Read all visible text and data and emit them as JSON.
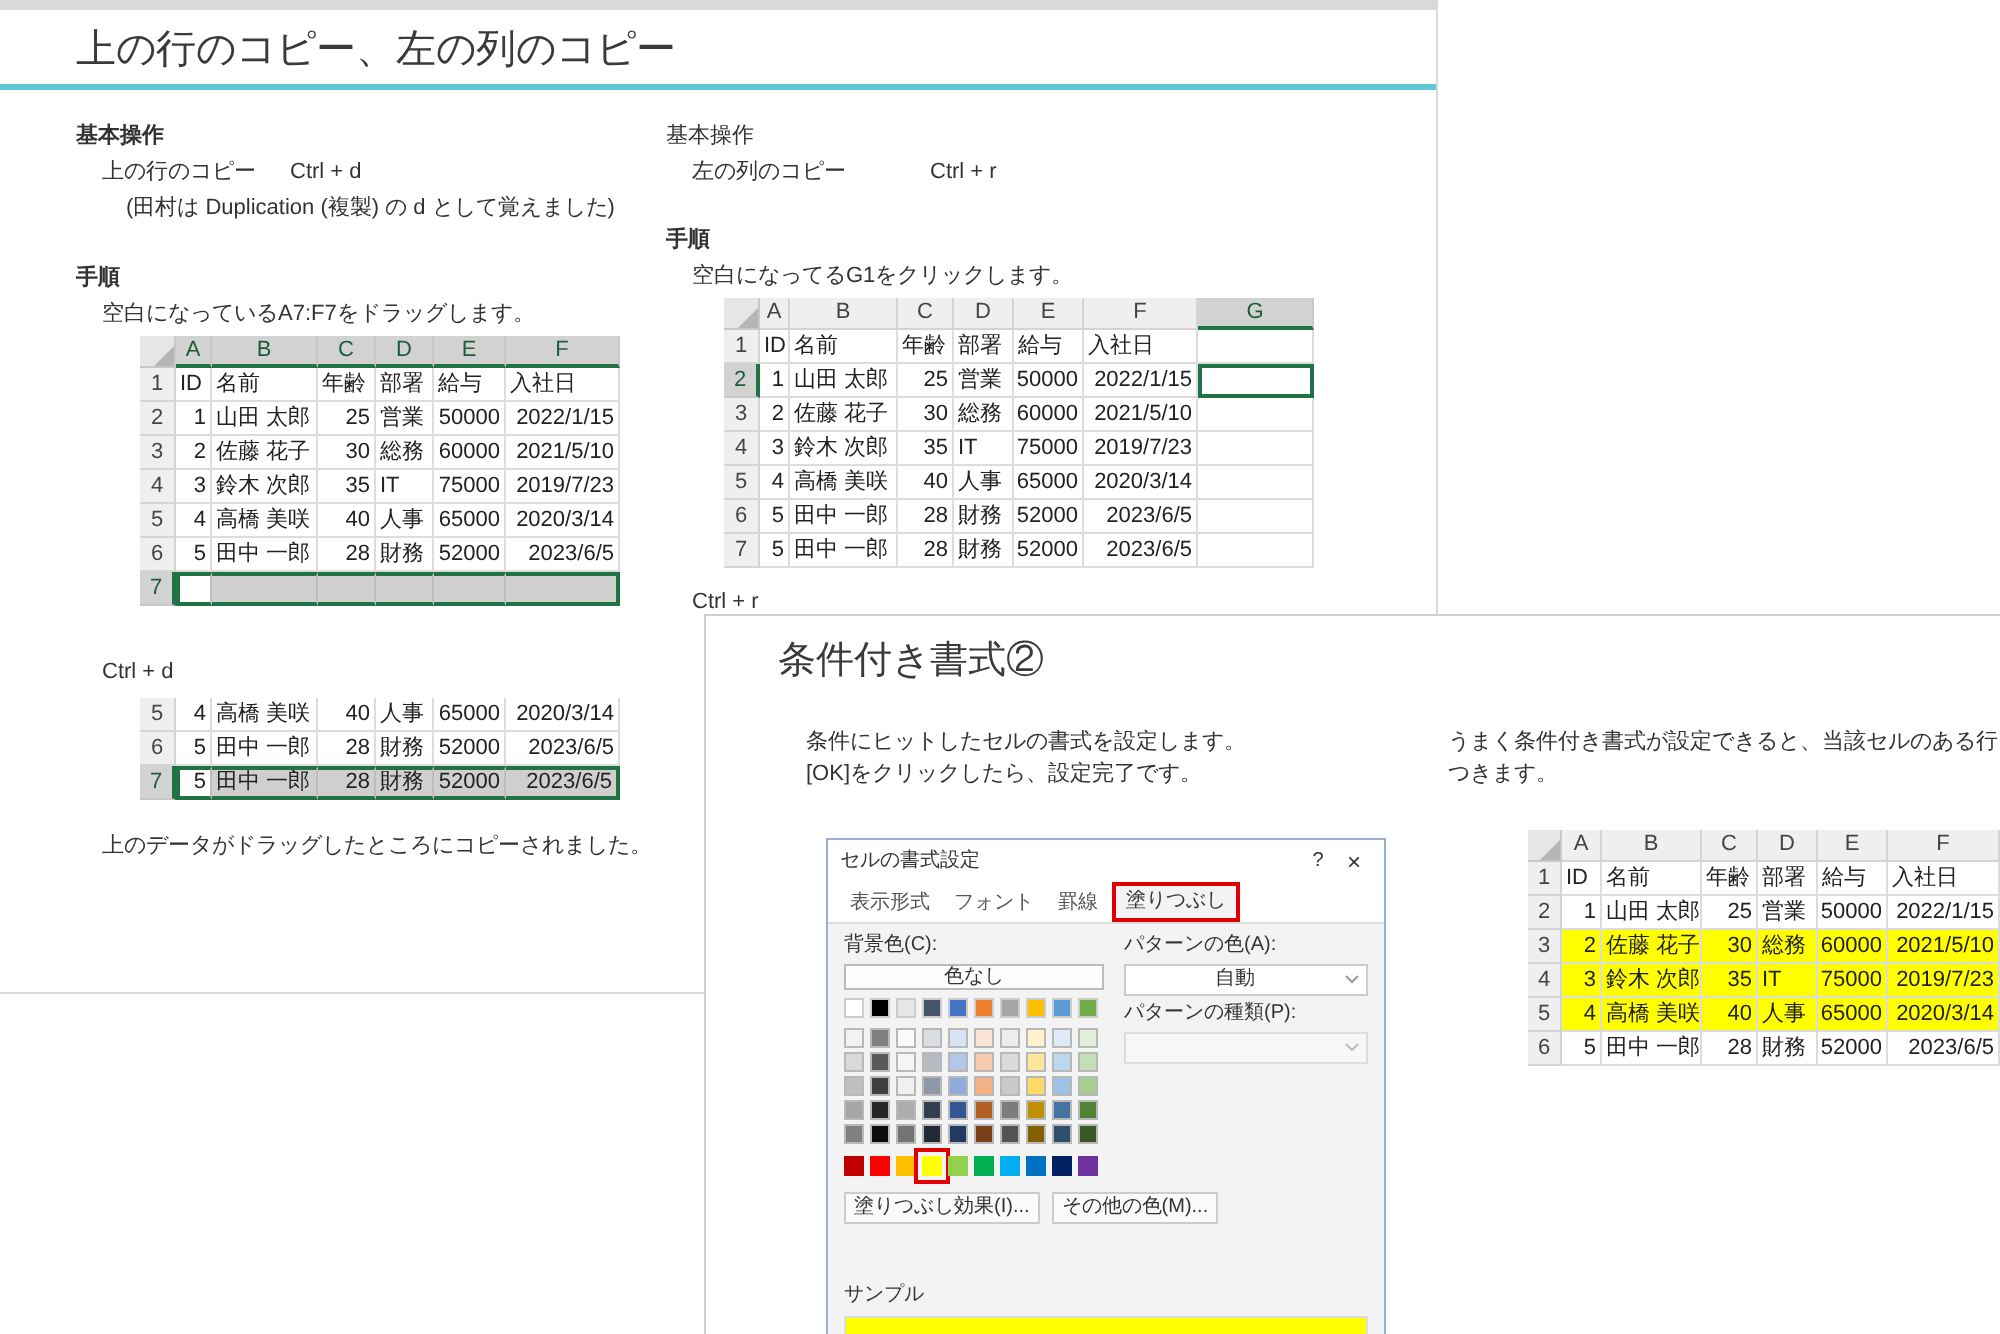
{
  "slide_1": {
    "title": "上の行のコピー、左の列のコピー",
    "left": {
      "heading": {
        "text": "基本操作",
        "bold": true
      },
      "shortcut_label": "上の行のコピー",
      "shortcut_keys": "Ctrl + d",
      "note": "(田村は Duplication (複製) の d として覚えました)",
      "steps_heading": "手順",
      "step": "空白になっているA7:F7をドラッグします。",
      "table": {
        "columns": [
          {
            "label": "A",
            "selected": true
          },
          {
            "label": "B",
            "selected": true
          },
          {
            "label": "C",
            "selected": true
          },
          {
            "label": "D",
            "selected": true
          },
          {
            "label": "E",
            "selected": true
          },
          {
            "label": "F",
            "selected": true
          }
        ],
        "rows": [
          {
            "number": "1",
            "selected": false,
            "cells": [
              "ID",
              "名前",
              "年齢",
              "部署",
              "給与",
              "入社日"
            ]
          },
          {
            "number": "2",
            "selected": false,
            "cells": [
              "1",
              "山田 太郎",
              "25",
              "営業",
              "50000",
              "2022/1/15"
            ]
          },
          {
            "number": "3",
            "selected": false,
            "cells": [
              "2",
              "佐藤 花子",
              "30",
              "総務",
              "60000",
              "2021/5/10"
            ]
          },
          {
            "number": "4",
            "selected": false,
            "cells": [
              "3",
              "鈴木 次郎",
              "35",
              "IT",
              "75000",
              "2019/7/23"
            ]
          },
          {
            "number": "5",
            "selected": false,
            "cells": [
              "4",
              "高橋 美咲",
              "40",
              "人事",
              "65000",
              "2020/3/14"
            ]
          },
          {
            "number": "6",
            "selected": false,
            "cells": [
              "5",
              "田中 一郎",
              "28",
              "財務",
              "52000",
              "2023/6/5"
            ]
          },
          {
            "number": "7",
            "selected": true,
            "cells": []
          }
        ]
      },
      "result_keys": "Ctrl + d",
      "result_table": {
        "rows": [
          {
            "number": "5",
            "selected": false,
            "cells": [
              "4",
              "高橋 美咲",
              "40",
              "人事",
              "65000",
              "2020/3/14"
            ]
          },
          {
            "number": "6",
            "selected": false,
            "cells": [
              "5",
              "田中 一郎",
              "28",
              "財務",
              "52000",
              "2023/6/5"
            ]
          },
          {
            "number": "7",
            "selected": true,
            "cells": [
              "5",
              "田中 一郎",
              "28",
              "財務",
              "52000",
              "2023/6/5"
            ]
          }
        ]
      },
      "result_text": "上のデータがドラッグしたところにコピーされました。"
    },
    "right": {
      "heading": {
        "text": "基本操作",
        "bold": false
      },
      "shortcut_label": "左の列のコピー",
      "shortcut_keys": "Ctrl + r",
      "steps_heading": "手順",
      "step": "空白になってるG1をクリックします。",
      "table": {
        "columns": [
          {
            "label": "A",
            "selected": false
          },
          {
            "label": "B",
            "selected": false
          },
          {
            "label": "C",
            "selected": false
          },
          {
            "label": "D",
            "selected": false
          },
          {
            "label": "E",
            "selected": false
          },
          {
            "label": "F",
            "selected": false
          },
          {
            "label": "G",
            "selected": true
          }
        ],
        "rows": [
          {
            "number": "1",
            "selected": false,
            "cells": [
              "ID",
              "名前",
              "年齢",
              "部署",
              "給与",
              "入社日"
            ]
          },
          {
            "number": "2",
            "selected": true,
            "cells": [
              "1",
              "山田 太郎",
              "25",
              "営業",
              "50000",
              "2022/1/15"
            ]
          },
          {
            "number": "3",
            "selected": false,
            "cells": [
              "2",
              "佐藤 花子",
              "30",
              "総務",
              "60000",
              "2021/5/10"
            ]
          },
          {
            "number": "4",
            "selected": false,
            "cells": [
              "3",
              "鈴木 次郎",
              "35",
              "IT",
              "75000",
              "2019/7/23"
            ]
          },
          {
            "number": "5",
            "selected": false,
            "cells": [
              "4",
              "高橋 美咲",
              "40",
              "人事",
              "65000",
              "2020/3/14"
            ]
          },
          {
            "number": "6",
            "selected": false,
            "cells": [
              "5",
              "田中 一郎",
              "28",
              "財務",
              "52000",
              "2023/6/5"
            ]
          },
          {
            "number": "7",
            "selected": false,
            "cells": [
              "5",
              "田中 一郎",
              "28",
              "財務",
              "52000",
              "2023/6/5"
            ]
          }
        ]
      },
      "result_keys": "Ctrl + r"
    }
  },
  "slide_2": {
    "title": "条件付き書式②",
    "left_lines": [
      "条件にヒットしたセルの書式を設定します。",
      "[OK]をクリックしたら、設定完了です。"
    ],
    "dialog": {
      "title": "セルの書式設定",
      "help": "?",
      "close": "×",
      "tabs": [
        {
          "label": "表示形式",
          "selected": false
        },
        {
          "label": "フォント",
          "selected": false
        },
        {
          "label": "罫線",
          "selected": false
        },
        {
          "label": "塗りつぶし",
          "selected": true
        }
      ],
      "background_label": "背景色(C):",
      "no_color": "色なし",
      "theme_colors": [
        {
          "color": "#ffffff"
        },
        {
          "color": "#000000"
        },
        {
          "color": "#e7e6e6"
        },
        {
          "color": "#44546a"
        },
        {
          "color": "#4472c4"
        },
        {
          "color": "#ed7d31"
        },
        {
          "color": "#a5a5a5"
        },
        {
          "color": "#ffc000"
        },
        {
          "color": "#5b9bd5"
        },
        {
          "color": "#70ad47"
        }
      ],
      "standard_colors": [
        {
          "color": "#c00000",
          "selected": false
        },
        {
          "color": "#ff0000",
          "selected": false
        },
        {
          "color": "#ffc000",
          "selected": false
        },
        {
          "color": "#ffff00",
          "selected": true
        },
        {
          "color": "#92d050",
          "selected": false
        },
        {
          "color": "#00b050",
          "selected": false
        },
        {
          "color": "#00b0f0",
          "selected": false
        },
        {
          "color": "#0070c0",
          "selected": false
        },
        {
          "color": "#002060",
          "selected": false
        },
        {
          "color": "#7030a0",
          "selected": false
        }
      ],
      "fill_effects": "塗りつぶし効果(I)...",
      "more_colors": "その他の色(M)...",
      "pattern_color_label": "パターンの色(A):",
      "pattern_color": "自動",
      "pattern_style_label": "パターンの種類(P):",
      "sample_label": "サンプル"
    },
    "right_lines": [
      "うまく条件付き書式が設定できると、当該セルのある行",
      "つきます。"
    ],
    "table": {
      "columns": [
        {
          "label": "A",
          "selected": false
        },
        {
          "label": "B",
          "selected": false
        },
        {
          "label": "C",
          "selected": false
        },
        {
          "label": "D",
          "selected": false
        },
        {
          "label": "E",
          "selected": false
        },
        {
          "label": "F",
          "selected": false
        }
      ],
      "rows": [
        {
          "number": "1",
          "selected": false,
          "highlighted": false,
          "cells": [
            "ID",
            "名前",
            "年齢",
            "部署",
            "給与",
            "入社日"
          ]
        },
        {
          "number": "2",
          "selected": false,
          "highlighted": false,
          "cells": [
            "1",
            "山田 太郎",
            "25",
            "営業",
            "50000",
            "2022/1/15"
          ]
        },
        {
          "number": "3",
          "selected": false,
          "highlighted": true,
          "cells": [
            "2",
            "佐藤 花子",
            "30",
            "総務",
            "60000",
            "2021/5/10"
          ]
        },
        {
          "number": "4",
          "selected": false,
          "highlighted": true,
          "cells": [
            "3",
            "鈴木 次郎",
            "35",
            "IT",
            "75000",
            "2019/7/23"
          ]
        },
        {
          "number": "5",
          "selected": false,
          "highlighted": true,
          "cells": [
            "4",
            "高橋 美咲",
            "40",
            "人事",
            "65000",
            "2020/3/14"
          ]
        },
        {
          "number": "6",
          "selected": false,
          "highlighted": false,
          "cells": [
            "5",
            "田中 一郎",
            "28",
            "財務",
            "52000",
            "2023/6/5"
          ]
        }
      ]
    }
  }
}
